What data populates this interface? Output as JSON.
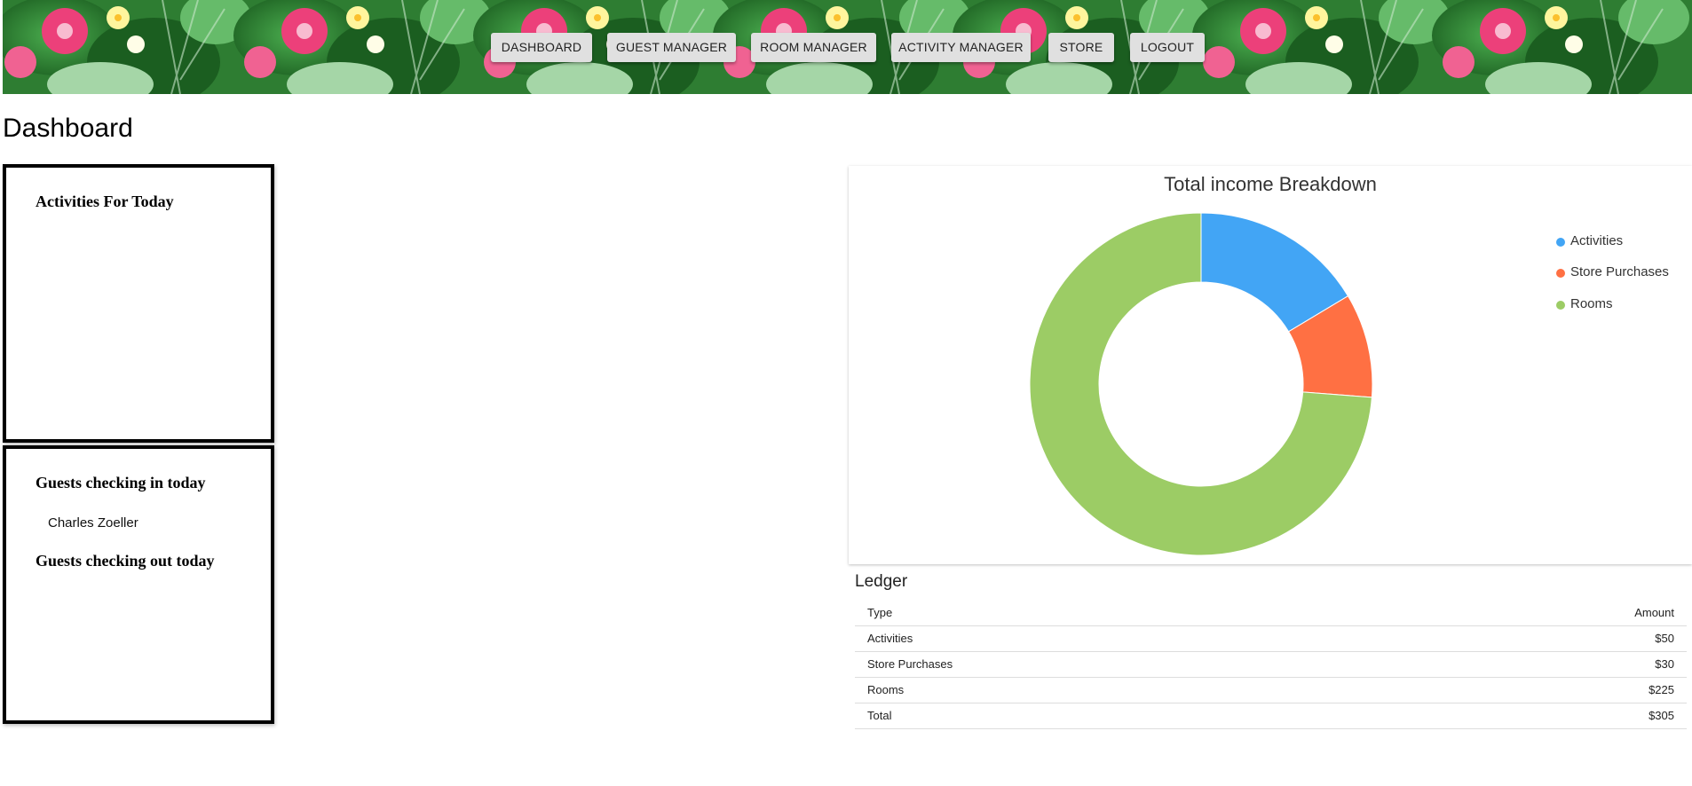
{
  "nav": {
    "items": [
      {
        "label": "DASHBOARD"
      },
      {
        "label": "GUEST MANAGER"
      },
      {
        "label": "ROOM MANAGER"
      },
      {
        "label": "ACTIVITY MANAGER"
      },
      {
        "label": "STORE"
      },
      {
        "label": "LOGOUT"
      }
    ]
  },
  "page": {
    "title": "Dashboard"
  },
  "activities_panel": {
    "heading": "Activities For Today"
  },
  "guests_panel": {
    "checkin_heading": "Guests checking in today",
    "checkin_guests": [
      "Charles Zoeller"
    ],
    "checkout_heading": "Guests checking out today"
  },
  "chart_data": {
    "type": "pie",
    "subtype": "doughnut",
    "title": "Total income Breakdown",
    "categories": [
      "Activities",
      "Store Purchases",
      "Rooms"
    ],
    "values": [
      50,
      30,
      225
    ],
    "colors": [
      "#42a5f5",
      "#ff7043",
      "#9ccc65"
    ],
    "legend": "right",
    "legend_labels": [
      "Activities",
      "Store Purchases",
      "Rooms"
    ]
  },
  "ledger": {
    "title": "Ledger",
    "columns": [
      "Type",
      "Amount"
    ],
    "rows": [
      {
        "type": "Activities",
        "amount": "$50"
      },
      {
        "type": "Store Purchases",
        "amount": "$30"
      },
      {
        "type": "Rooms",
        "amount": "$225"
      },
      {
        "type": "Total",
        "amount": "$305"
      }
    ]
  }
}
